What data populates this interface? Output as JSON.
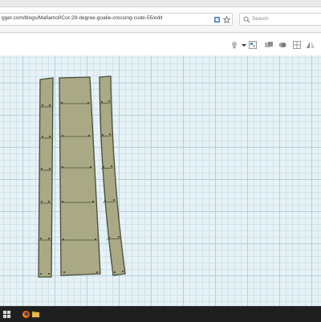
{
  "browser": {
    "url": "gger.com/blogs/Mafiamo0Cor-29-degree-goalie-crossing-code-55/edit",
    "search_placeholder": "Search"
  },
  "colors": {
    "grid_bg": "#e6f2f6",
    "panel_fill": "#a9a985",
    "panel_stroke": "#4b4b3a"
  }
}
